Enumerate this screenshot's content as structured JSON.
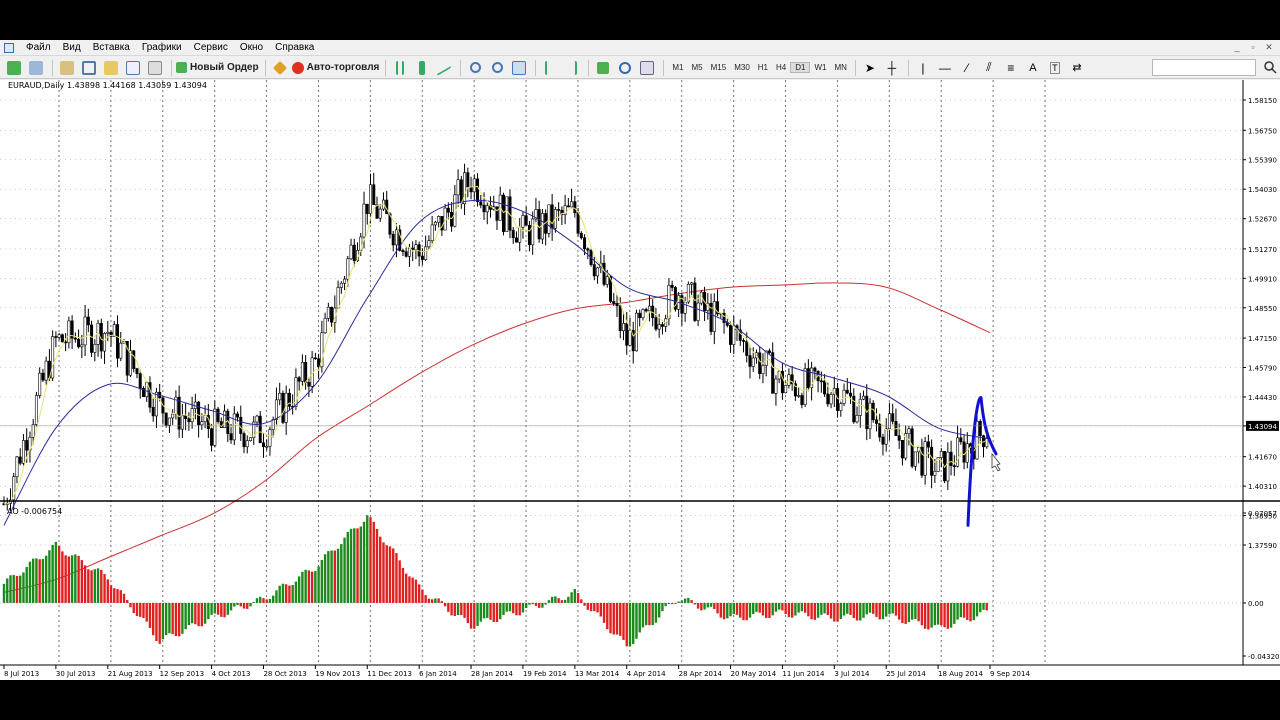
{
  "menu": {
    "items": [
      "Файл",
      "Вид",
      "Вставка",
      "Графики",
      "Сервис",
      "Окно",
      "Справка"
    ],
    "window_controls": [
      "_",
      "▫",
      "✕"
    ]
  },
  "toolbar": {
    "new_order_label": "Новый Ордер",
    "auto_trading_label": "Авто-торговля",
    "timeframes": [
      "M1",
      "M5",
      "M15",
      "M30",
      "H1",
      "H4",
      "D1",
      "W1",
      "MN"
    ],
    "active_timeframe": "D1",
    "search_value": ""
  },
  "chart": {
    "header": "EURAUD,Daily  1.43898 1.44168 1.43059 1.43094",
    "price_ticks": [
      "1.58150",
      "1.56750",
      "1.55390",
      "1.54030",
      "1.52670",
      "1.51270",
      "1.49910",
      "1.48550",
      "1.47150",
      "1.45790",
      "1.44430",
      "1.43094",
      "1.41670",
      "1.40310",
      "1.38950",
      "1.37590"
    ],
    "current_price": "1.43094",
    "date_ticks": [
      "8 Jul 2013",
      "30 Jul 2013",
      "21 Aug 2013",
      "12 Sep 2013",
      "4 Oct 2013",
      "28 Oct 2013",
      "19 Nov 2013",
      "11 Dec 2013",
      "6 Jan 2014",
      "28 Jan 2014",
      "19 Feb 2014",
      "13 Mar 2014",
      "4 Apr 2014",
      "28 Apr 2014",
      "20 May 2014",
      "11 Jun 2014",
      "3 Jul 2014",
      "25 Jul 2014",
      "18 Aug 2014",
      "9 Sep 2014"
    ],
    "indicator_label": "AO -0.006754",
    "indicator_ticks": [
      "0.07057",
      "0.00",
      "-0.043202"
    ],
    "colors": {
      "candles": "#000000",
      "ma_fast": "#e8e070",
      "ma_mid": "#2a2aa0",
      "ma_slow": "#cc3030",
      "ao_up": "#1a8a1a",
      "ao_down": "#e02020",
      "annotation": "#1010d0",
      "price_marker": "#000000"
    }
  },
  "chart_data": {
    "type": "line",
    "title": "EURAUD,Daily",
    "x": [
      "8 Jul 2013",
      "30 Jul 2013",
      "21 Aug 2013",
      "12 Sep 2013",
      "4 Oct 2013",
      "28 Oct 2013",
      "19 Nov 2013",
      "11 Dec 2013",
      "6 Jan 2014",
      "28 Jan 2014",
      "19 Feb 2014",
      "13 Mar 2014",
      "4 Apr 2014",
      "28 Apr 2014",
      "20 May 2014",
      "11 Jun 2014",
      "3 Jul 2014",
      "25 Jul 2014",
      "18 Aug 2014",
      "9 Sep 2014"
    ],
    "series": [
      {
        "values": [
          1.395,
          1.47,
          1.475,
          1.44,
          1.43,
          1.428,
          1.46,
          1.535,
          1.51,
          1.545,
          1.52,
          1.53,
          1.47,
          1.493,
          1.475,
          1.45,
          1.448,
          1.43,
          1.41,
          1.431
        ]
      },
      {
        "values": [
          1.385,
          1.43,
          1.45,
          1.445,
          1.438,
          1.432,
          1.45,
          1.49,
          1.525,
          1.535,
          1.53,
          1.515,
          1.495,
          1.488,
          1.478,
          1.46,
          1.453,
          1.445,
          1.43,
          1.425
        ]
      },
      {
        "values": [
          1.354,
          1.36,
          1.37,
          1.38,
          1.39,
          1.405,
          1.425,
          1.44,
          1.455,
          1.468,
          1.478,
          1.485,
          1.488,
          1.492,
          1.495,
          1.496,
          1.497,
          1.495,
          1.485,
          1.474
        ]
      }
    ],
    "ao": {
      "title": "AO -0.006754",
      "x": [
        "8 Jul 2013",
        "30 Jul 2013",
        "21 Aug 2013",
        "12 Sep 2013",
        "4 Oct 2013",
        "28 Oct 2013",
        "19 Nov 2013",
        "11 Dec 2013",
        "6 Jan 2014",
        "28 Jan 2014",
        "19 Feb 2014",
        "13 Mar 2014",
        "4 Apr 2014",
        "28 Apr 2014",
        "20 May 2014",
        "11 Jun 2014",
        "3 Jul 2014",
        "25 Jul 2014",
        "18 Aug 2014",
        "9 Sep 2014"
      ],
      "values": [
        0.015,
        0.045,
        0.02,
        -0.03,
        -0.012,
        0.003,
        0.028,
        0.068,
        0.012,
        -0.018,
        -0.006,
        0.008,
        -0.034,
        0.004,
        -0.012,
        -0.008,
        -0.012,
        -0.01,
        -0.02,
        -0.006754
      ],
      "ylim": [
        -0.043202,
        0.07057
      ]
    },
    "ylim": [
      1.3759,
      1.5815
    ],
    "grid": true
  }
}
